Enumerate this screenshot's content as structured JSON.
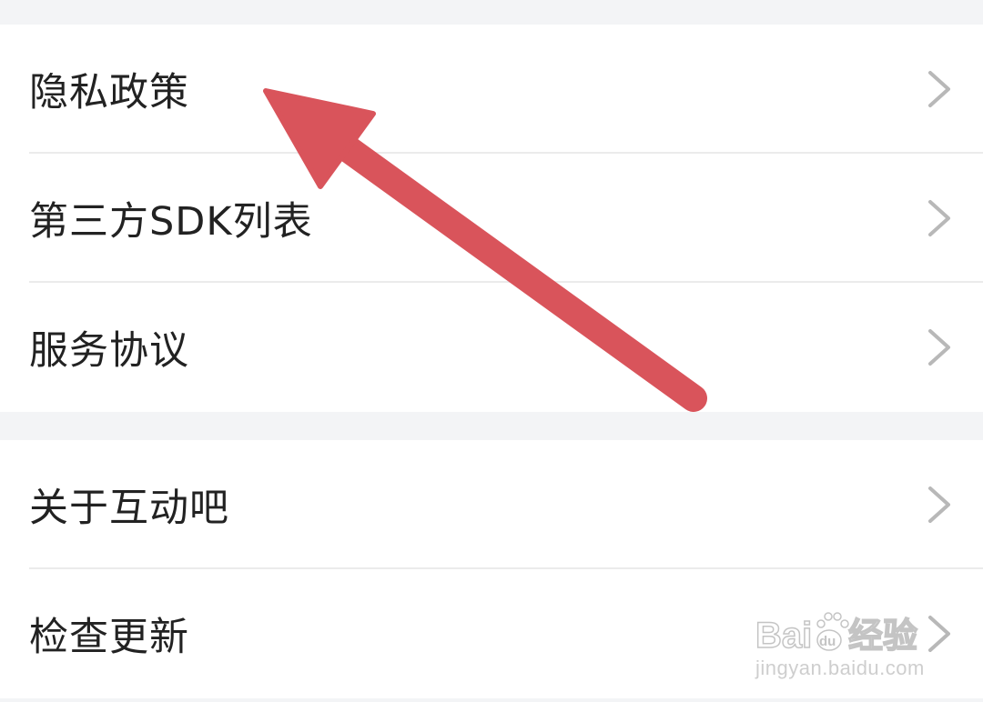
{
  "settings": {
    "group1": [
      {
        "label": "隐私政策"
      },
      {
        "label": "第三方SDK列表"
      },
      {
        "label": "服务协议"
      }
    ],
    "group2": [
      {
        "label": "关于互动吧"
      },
      {
        "label": "检查更新"
      }
    ]
  },
  "annotation": {
    "arrow_color": "#d9545b"
  },
  "watermark": {
    "logo_text": "Baidu经验",
    "url": "jingyan.baidu.com"
  },
  "colors": {
    "background": "#f3f4f6",
    "row_background": "#ffffff",
    "text": "#222222",
    "chevron": "#b8b8b8",
    "divider": "#ebebeb"
  }
}
